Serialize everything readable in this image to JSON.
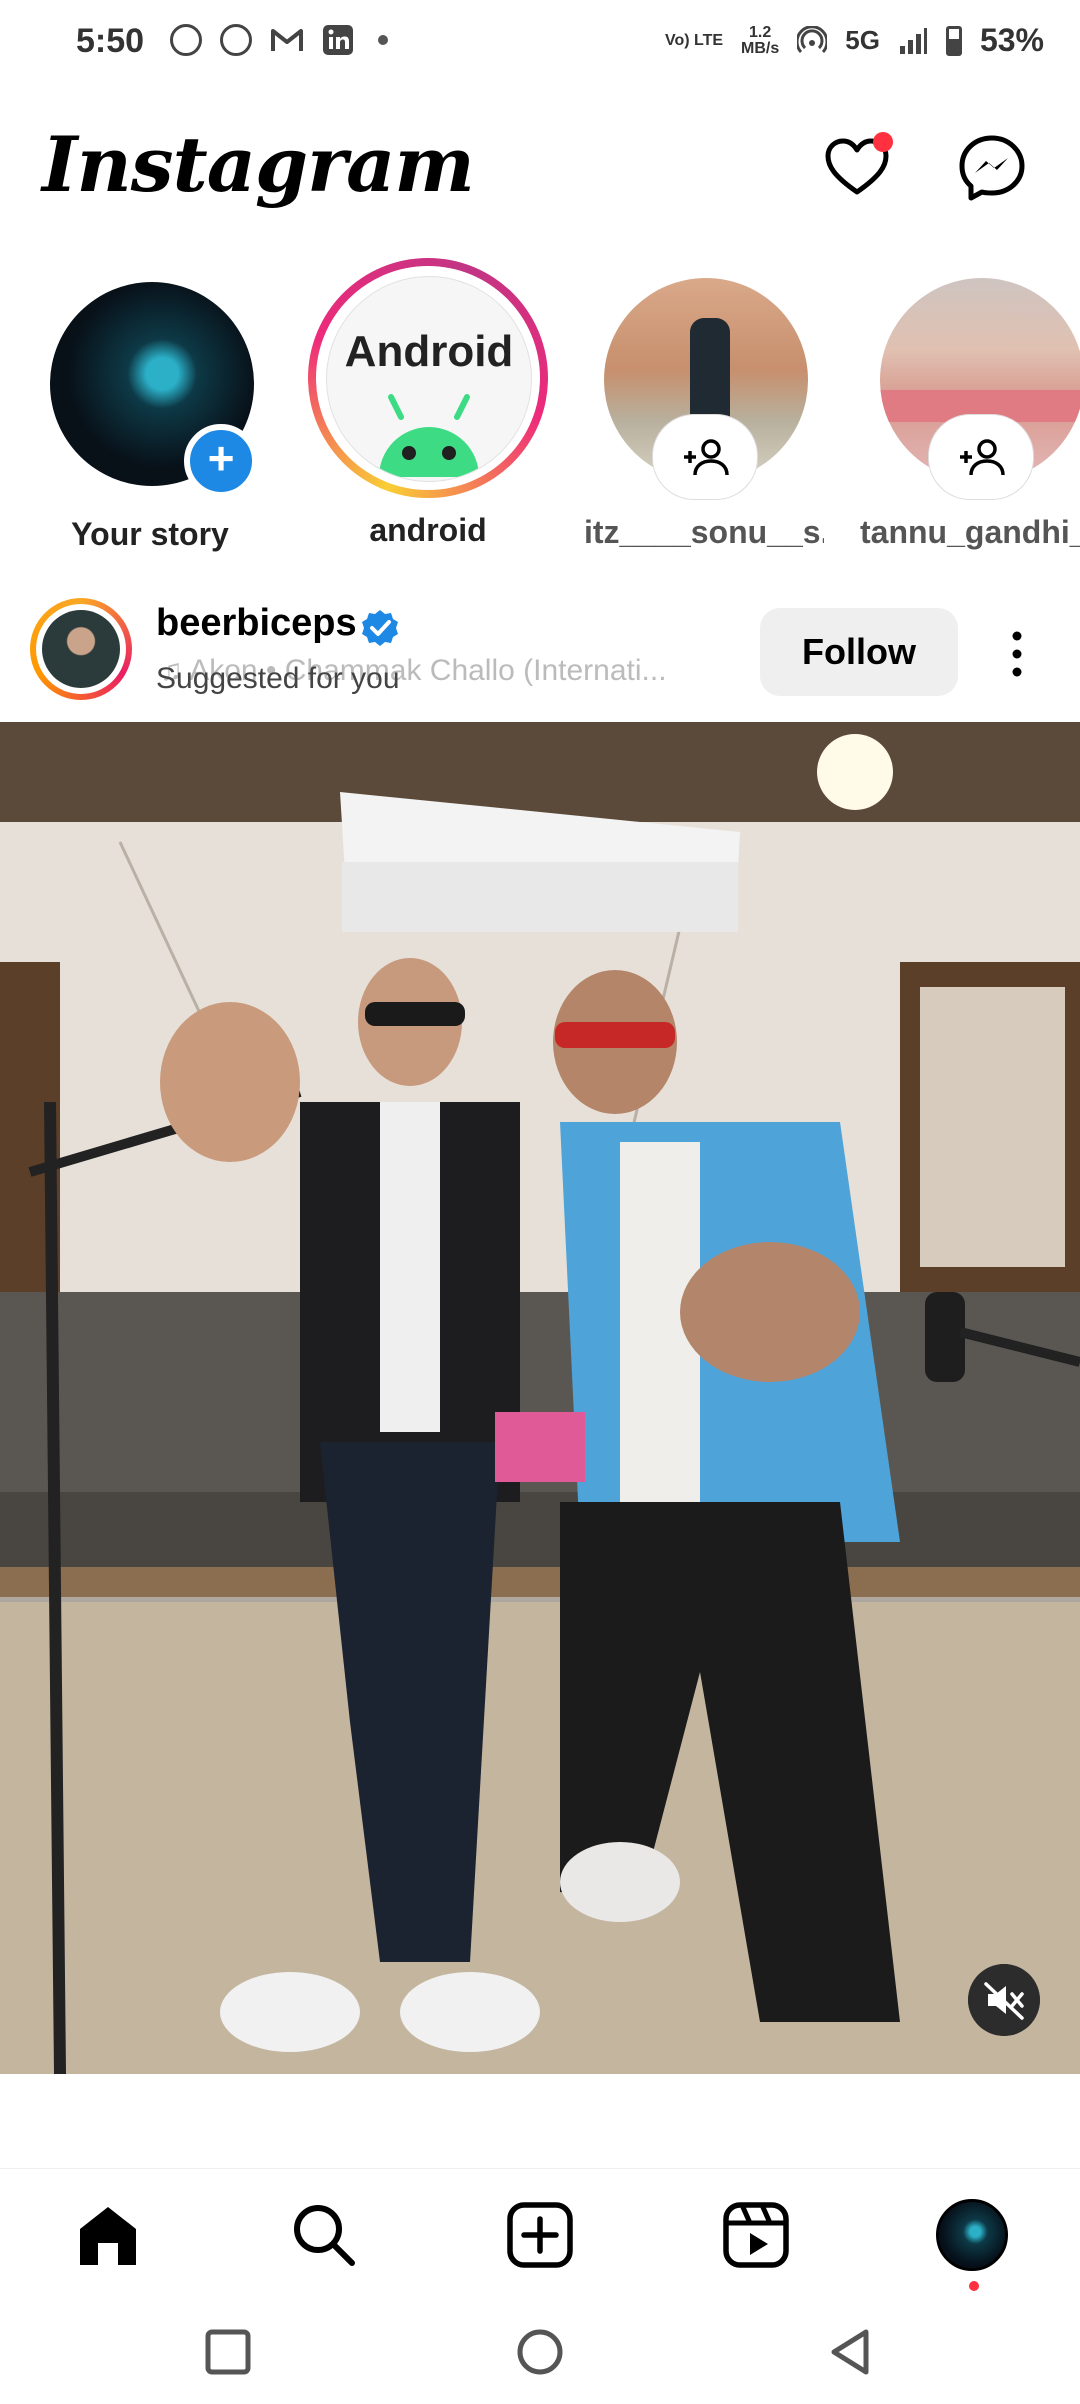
{
  "status_bar": {
    "time": "5:50",
    "volte": "Vo) LTE",
    "speed_top": "1.2",
    "speed_bottom": "MB/s",
    "network": "5G",
    "battery": "53%"
  },
  "header": {
    "logo": "Instagram",
    "icons": [
      "heart-icon",
      "messenger-icon"
    ],
    "badge_color": "#ff3040"
  },
  "stories": [
    {
      "label": "Your story"
    },
    {
      "label": "android",
      "avatar_text": "Android"
    },
    {
      "label": "itz____sonu__s..."
    },
    {
      "label": "tannu_gandhi_."
    }
  ],
  "post": {
    "username": "beerbiceps",
    "audio": "Akon • Chammak Challo (Internati...",
    "subtitle": "Suggested for you",
    "follow_label": "Follow"
  },
  "bottom_nav": {
    "items": [
      "home-icon",
      "search-icon",
      "create-icon",
      "reels-icon",
      "profile-avatar"
    ]
  },
  "colors": {
    "accent": "#0095f6",
    "verified": "#1e88e5",
    "story_ring_start": "#f9ce34",
    "story_ring_mid": "#ee2a7b",
    "story_ring_end": "#c13584"
  }
}
